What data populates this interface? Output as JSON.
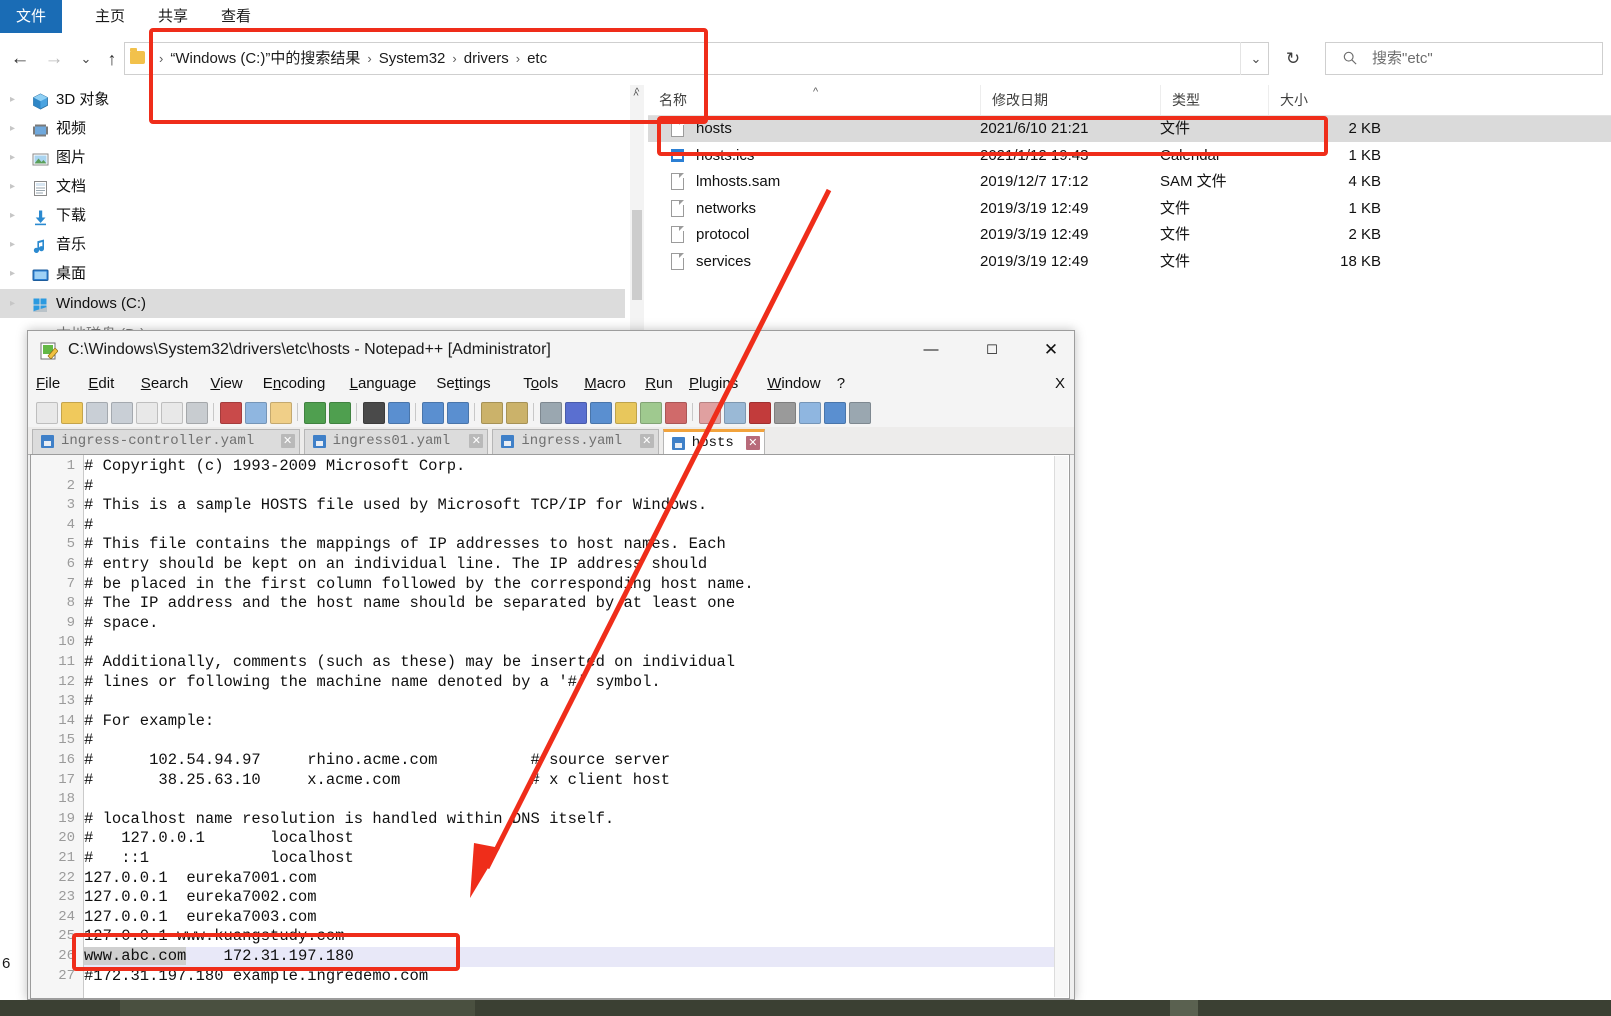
{
  "explorer": {
    "ribbon_tabs": [
      {
        "label": "文件",
        "name": "ribbon-tab-file"
      },
      {
        "label": "主页",
        "name": "ribbon-tab-home"
      },
      {
        "label": "共享",
        "name": "ribbon-tab-share"
      },
      {
        "label": "查看",
        "name": "ribbon-tab-view"
      }
    ],
    "nav": {
      "back_icon": "arrow-left-icon",
      "forward_icon": "arrow-right-icon",
      "recent_icon": "chevron-down-icon",
      "up_icon": "arrow-up-icon"
    },
    "address": {
      "crumbs": [
        "“Windows (C:)”中的搜索结果",
        "System32",
        "drivers",
        "etc"
      ],
      "separator": "›",
      "dropdown_icon": "chevron-down-icon",
      "refresh_icon": "refresh-icon"
    },
    "search": {
      "placeholder": "搜索\"etc\"",
      "icon": "search-icon"
    },
    "sidebar": {
      "items": [
        {
          "label": "3D 对象",
          "icon": "3d-object-icon",
          "selected": false
        },
        {
          "label": "视频",
          "icon": "video-icon",
          "selected": false
        },
        {
          "label": "图片",
          "icon": "picture-icon",
          "selected": false
        },
        {
          "label": "文档",
          "icon": "document-icon",
          "selected": false
        },
        {
          "label": "下载",
          "icon": "download-icon",
          "selected": false
        },
        {
          "label": "音乐",
          "icon": "music-icon",
          "selected": false
        },
        {
          "label": "桌面",
          "icon": "desktop-icon",
          "selected": false
        },
        {
          "label": "Windows (C:)",
          "icon": "drive-icon",
          "selected": true
        }
      ]
    },
    "filelist": {
      "columns": [
        {
          "label": "名称",
          "key": "name"
        },
        {
          "label": "修改日期",
          "key": "date"
        },
        {
          "label": "类型",
          "key": "type"
        },
        {
          "label": "大小",
          "key": "size"
        }
      ],
      "sort_indicator": "chevron-up-icon",
      "rows": [
        {
          "name": "hosts",
          "date": "2021/6/10 21:21",
          "type": "文件",
          "size": "2 KB",
          "icon": "file-icon",
          "selected": true
        },
        {
          "name": "hosts.ics",
          "date": "2021/1/12 19:43",
          "type": "Calendar",
          "size": "1 KB",
          "icon": "calendar-file-icon",
          "selected": false
        },
        {
          "name": "lmhosts.sam",
          "date": "2019/12/7 17:12",
          "type": "SAM 文件",
          "size": "4 KB",
          "icon": "file-icon",
          "selected": false
        },
        {
          "name": "networks",
          "date": "2019/3/19 12:49",
          "type": "文件",
          "size": "1 KB",
          "icon": "file-icon",
          "selected": false
        },
        {
          "name": "protocol",
          "date": "2019/3/19 12:49",
          "type": "文件",
          "size": "2 KB",
          "icon": "file-icon",
          "selected": false
        },
        {
          "name": "services",
          "date": "2019/3/19 12:49",
          "type": "文件",
          "size": "18 KB",
          "icon": "file-icon",
          "selected": false
        }
      ]
    }
  },
  "notepad": {
    "title": "C:\\Windows\\System32\\drivers\\etc\\hosts - Notepad++ [Administrator]",
    "app_icon": "notepadpp-icon",
    "window_buttons": {
      "minimize": "—",
      "maximize": "☐",
      "close": "✕"
    },
    "menu_close_label": "X",
    "menu": [
      {
        "label": "File",
        "accel": "F"
      },
      {
        "label": "Edit",
        "accel": "E"
      },
      {
        "label": "Search",
        "accel": "S"
      },
      {
        "label": "View",
        "accel": "V"
      },
      {
        "label": "Encoding",
        "accel": "n"
      },
      {
        "label": "Language",
        "accel": "L"
      },
      {
        "label": "Settings",
        "accel": "t"
      },
      {
        "label": "Tools",
        "accel": "o"
      },
      {
        "label": "Macro",
        "accel": "M"
      },
      {
        "label": "Run",
        "accel": "R"
      },
      {
        "label": "Plugins",
        "accel": "P"
      },
      {
        "label": "Window",
        "accel": "W"
      },
      {
        "label": "?",
        "accel": ""
      }
    ],
    "toolbar_icons": [
      "new-file-icon",
      "open-file-icon",
      "save-icon",
      "save-all-icon",
      "close-file-icon",
      "close-all-icon",
      "print-icon",
      "cut-icon",
      "copy-icon",
      "paste-icon",
      "undo-icon",
      "redo-icon",
      "find-icon",
      "replace-icon",
      "zoom-in-icon",
      "zoom-out-icon",
      "sync-vertical-icon",
      "sync-horizontal-icon",
      "word-wrap-icon",
      "show-all-chars-icon",
      "indent-guide-icon",
      "user-defined-dialog-icon",
      "document-map-icon",
      "function-list-icon",
      "folder-as-workspace-icon",
      "monitoring-icon",
      "record-macro-icon",
      "stop-macro-icon",
      "play-macro-icon",
      "run-macro-multiple-icon",
      "save-macro-icon"
    ],
    "tabs": [
      {
        "label": "ingress-controller.yaml",
        "active": false,
        "icon": "saved-file-icon",
        "close": "✕"
      },
      {
        "label": "ingress01.yaml",
        "active": false,
        "icon": "saved-file-icon",
        "close": "✕"
      },
      {
        "label": "ingress.yaml",
        "active": false,
        "icon": "saved-file-icon",
        "close": "✕"
      },
      {
        "label": "hosts",
        "active": true,
        "icon": "saved-file-icon",
        "close": "✕"
      }
    ],
    "editor": {
      "current_line": 26,
      "selected_token": "www.abc.com",
      "lines": [
        {
          "n": 1,
          "text": "# Copyright (c) 1993-2009 Microsoft Corp."
        },
        {
          "n": 2,
          "text": "#"
        },
        {
          "n": 3,
          "text": "# This is a sample HOSTS file used by Microsoft TCP/IP for Windows."
        },
        {
          "n": 4,
          "text": "#"
        },
        {
          "n": 5,
          "text": "# This file contains the mappings of IP addresses to host names. Each"
        },
        {
          "n": 6,
          "text": "# entry should be kept on an individual line. The IP address should"
        },
        {
          "n": 7,
          "text": "# be placed in the first column followed by the corresponding host name."
        },
        {
          "n": 8,
          "text": "# The IP address and the host name should be separated by at least one"
        },
        {
          "n": 9,
          "text": "# space."
        },
        {
          "n": 10,
          "text": "#"
        },
        {
          "n": 11,
          "text": "# Additionally, comments (such as these) may be inserted on individual"
        },
        {
          "n": 12,
          "text": "# lines or following the machine name denoted by a '#' symbol."
        },
        {
          "n": 13,
          "text": "#"
        },
        {
          "n": 14,
          "text": "# For example:"
        },
        {
          "n": 15,
          "text": "#"
        },
        {
          "n": 16,
          "text": "#      102.54.94.97     rhino.acme.com          # source server"
        },
        {
          "n": 17,
          "text": "#       38.25.63.10     x.acme.com              # x client host"
        },
        {
          "n": 18,
          "text": ""
        },
        {
          "n": 19,
          "text": "# localhost name resolution is handled within DNS itself."
        },
        {
          "n": 20,
          "text": "#   127.0.0.1       localhost"
        },
        {
          "n": 21,
          "text": "#   ::1             localhost"
        },
        {
          "n": 22,
          "text": "127.0.0.1  eureka7001.com"
        },
        {
          "n": 23,
          "text": "127.0.0.1  eureka7002.com"
        },
        {
          "n": 24,
          "text": "127.0.0.1  eureka7003.com"
        },
        {
          "n": 25,
          "text": "127.0.0.1 www.kuangstudy.com"
        },
        {
          "n": 26,
          "text": "www.abc.com    172.31.197.180"
        },
        {
          "n": 27,
          "text": "#172.31.197.180 example.ingredemo.com"
        }
      ]
    }
  },
  "annotations": {
    "accent_color": "#ef2d1a",
    "boxes": [
      {
        "name": "address-bar-highlight"
      },
      {
        "name": "hosts-row-highlight"
      },
      {
        "name": "hosts-entry-line-highlight"
      }
    ],
    "arrow": {
      "name": "pointer-arrow",
      "from": "hosts-file-row",
      "to": "hosts-entry-line"
    }
  },
  "misc": {
    "left_margin_number": "6"
  }
}
